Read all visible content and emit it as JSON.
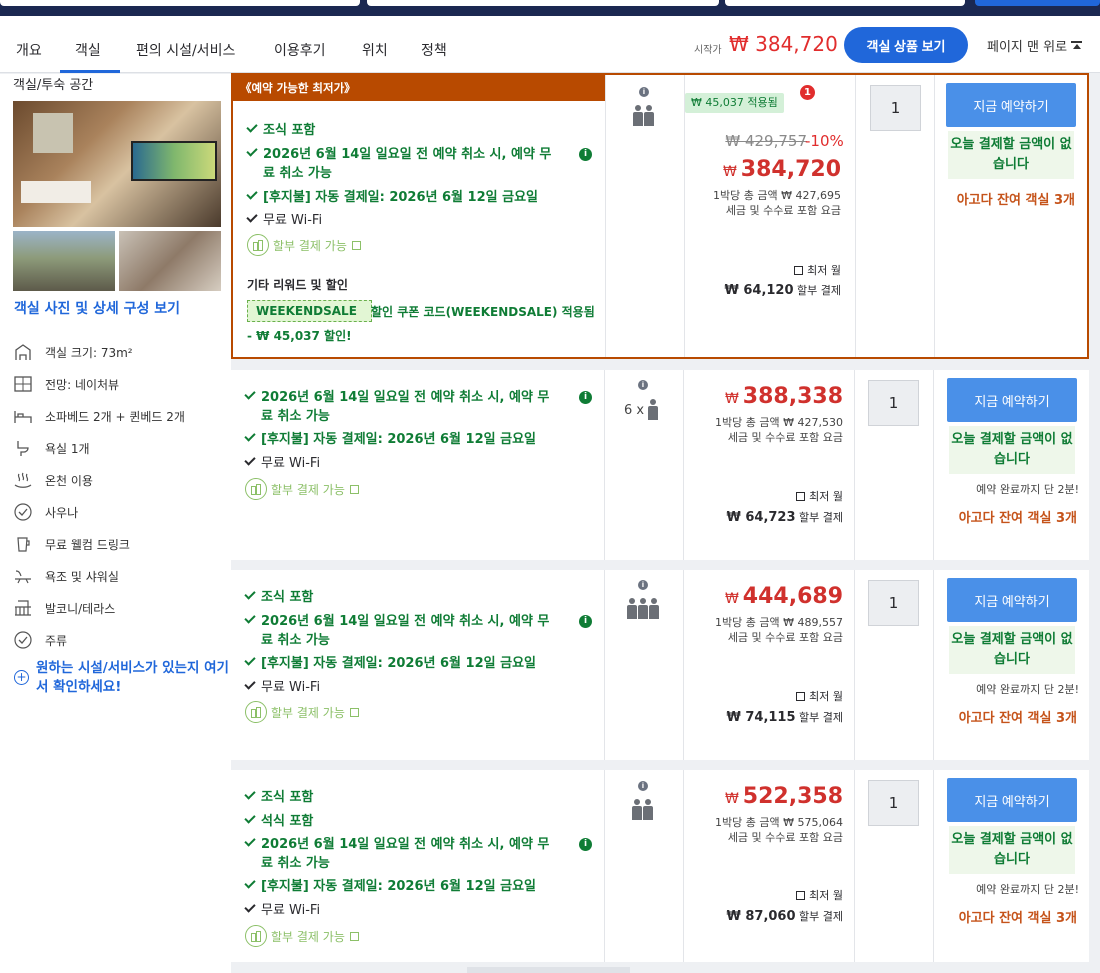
{
  "nav": {
    "tabs": [
      "개요",
      "객실",
      "편의 시설/서비스",
      "이용후기",
      "위치",
      "정책"
    ],
    "start_label": "시작가",
    "start_price": "₩ 384,720",
    "view_rooms_button": "객실 상품 보기",
    "to_top": "페이지 맨 위로"
  },
  "sidebar": {
    "title": "객실/투숙 공간",
    "photos_link": "객실 사진 및 상세 구성 보기",
    "amenities": [
      {
        "icon": "room-size-icon",
        "label": "객실 크기: 73m²"
      },
      {
        "icon": "view-icon",
        "label": "전망: 네이처뷰"
      },
      {
        "icon": "bed-icon",
        "label": "소파베드 2개 + 퀸베드 2개"
      },
      {
        "icon": "bathroom-icon",
        "label": "욕실 1개"
      },
      {
        "icon": "hot-spring-icon",
        "label": "온천 이용"
      },
      {
        "icon": "check-circle-icon",
        "label": "사우나"
      },
      {
        "icon": "drink-icon",
        "label": "무료 웰컴 드링크"
      },
      {
        "icon": "bath-shower-icon",
        "label": "욕조 및 샤워실"
      },
      {
        "icon": "balcony-icon",
        "label": "발코니/테라스"
      },
      {
        "icon": "check-circle-icon",
        "label": "주류"
      }
    ],
    "more_link": "원하는 시설/서비스가 있는지 여기서 확인하세요!"
  },
  "offers": [
    {
      "best_label": "《예약 가능한 최저가》",
      "features": {
        "breakfast": "조식 포함",
        "cancel_1": "2026년 6월 14일 일요일 전 예약 취소 시, 예약 무",
        "cancel_2": "료 취소 가능",
        "postpay": "[후지불] 자동 결제일: 2026년 6월 12일 금요일",
        "wifi": "무료 Wi-Fi",
        "installment": "할부 결제 가능"
      },
      "other_rewards_title": "기타 리워드 및 할인",
      "coupon_code": "WEEKENDSALE",
      "coupon_applied": "할인 쿠폰 코드(WEEKENDSALE) 적용됨",
      "coupon_discount": "- ₩ 45,037 할인!",
      "guests": "",
      "promo_applied": "₩ 45,037 적용됨",
      "promo_count": "1",
      "original_price": "₩ 429,757",
      "discount_pct": "-10%",
      "currency": "₩",
      "price": "384,720",
      "per_night": "1박당 총 금액 ₩ 427,695",
      "incl_tax": "세금 및 수수료 포함 요금",
      "monthly_label": "최저 월",
      "monthly_amount": "₩ 64,120",
      "monthly_suffix": "할부 결제",
      "quantity": "1",
      "book_button": "지금 예약하기",
      "no_pay_today": "오늘 결제할 금액이 없습니다",
      "remaining": "아고다 잔여 객실 3개"
    },
    {
      "features": {
        "cancel_1": "2026년 6월 14일 일요일 전 예약 취소 시, 예약 무",
        "cancel_2": "료 취소 가능",
        "postpay": "[후지불] 자동 결제일: 2026년 6월 12일 금요일",
        "wifi": "무료 Wi-Fi",
        "installment": "할부 결제 가능"
      },
      "guests": "6 x",
      "currency": "₩",
      "price": "388,338",
      "per_night": "1박당 총 금액 ₩ 427,530",
      "incl_tax": "세금 및 수수료 포함 요금",
      "monthly_label": "최저 월",
      "monthly_amount": "₩ 64,723",
      "monthly_suffix": "할부 결제",
      "quantity": "1",
      "book_button": "지금 예약하기",
      "no_pay_today": "오늘 결제할 금액이 없습니다",
      "until_complete": "예약 완료까지 단 2분!",
      "remaining": "아고다 잔여 객실 3개"
    },
    {
      "features": {
        "breakfast": "조식 포함",
        "cancel_1": "2026년 6월 14일 일요일 전 예약 취소 시, 예약 무",
        "cancel_2": "료 취소 가능",
        "postpay": "[후지불] 자동 결제일: 2026년 6월 12일 금요일",
        "wifi": "무료 Wi-Fi",
        "installment": "할부 결제 가능"
      },
      "currency": "₩",
      "price": "444,689",
      "per_night": "1박당 총 금액 ₩ 489,557",
      "incl_tax": "세금 및 수수료 포함 요금",
      "monthly_label": "최저 월",
      "monthly_amount": "₩ 74,115",
      "monthly_suffix": "할부 결제",
      "quantity": "1",
      "book_button": "지금 예약하기",
      "no_pay_today": "오늘 결제할 금액이 없습니다",
      "until_complete": "예약 완료까지 단 2분!",
      "remaining": "아고다 잔여 객실 3개"
    },
    {
      "features": {
        "breakfast": "조식 포함",
        "dinner": "석식 포함",
        "cancel_1": "2026년 6월 14일 일요일 전 예약 취소 시, 예약 무",
        "cancel_2": "료 취소 가능",
        "postpay": "[후지불] 자동 결제일: 2026년 6월 12일 금요일",
        "wifi": "무료 Wi-Fi",
        "installment": "할부 결제 가능"
      },
      "currency": "₩",
      "price": "522,358",
      "per_night": "1박당 총 금액 ₩ 575,064",
      "incl_tax": "세금 및 수수료 포함 요금",
      "monthly_label": "최저 월",
      "monthly_amount": "₩ 87,060",
      "monthly_suffix": "할부 결제",
      "quantity": "1",
      "book_button": "지금 예약하기",
      "no_pay_today": "오늘 결제할 금액이 없습니다",
      "until_complete": "예약 완료까지 단 2분!",
      "remaining": "아고다 잔여 객실 3개"
    }
  ],
  "colors": {
    "brand_blue": "#2067da",
    "price_red": "#d0312d",
    "best_border": "#b84a00",
    "green": "#0f7c35",
    "remaining_orange": "#c5531a"
  }
}
